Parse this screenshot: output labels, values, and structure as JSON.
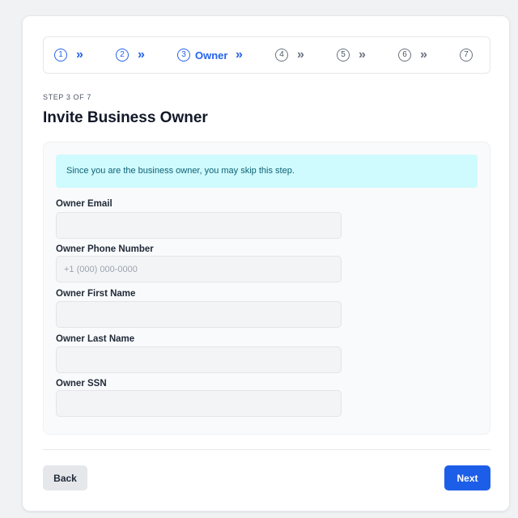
{
  "stepper": {
    "steps": [
      {
        "number": "1",
        "label": "",
        "state": "done"
      },
      {
        "number": "2",
        "label": "",
        "state": "done"
      },
      {
        "number": "3",
        "label": "Owner",
        "state": "current"
      },
      {
        "number": "4",
        "label": "",
        "state": "upcoming"
      },
      {
        "number": "5",
        "label": "",
        "state": "upcoming"
      },
      {
        "number": "6",
        "label": "",
        "state": "upcoming"
      },
      {
        "number": "7",
        "label": "",
        "state": "upcoming"
      }
    ],
    "separator_glyph": "»",
    "active_color": "#2563eb",
    "inactive_color": "#6b7280"
  },
  "header": {
    "kicker": "STEP 3 OF 7",
    "title": "Invite Business Owner"
  },
  "notice": {
    "text": "Since you are the business owner, you may skip this step.",
    "background": "#cffafe"
  },
  "form": {
    "fields": [
      {
        "label": "Owner Email",
        "value": "",
        "placeholder": ""
      },
      {
        "label": "Owner Phone Number",
        "value": "",
        "placeholder": "+1 (000) 000-0000"
      },
      {
        "label": "Owner First Name",
        "value": "",
        "placeholder": ""
      },
      {
        "label": "Owner Last Name",
        "value": "",
        "placeholder": ""
      },
      {
        "label": "Owner SSN",
        "value": "",
        "placeholder": ""
      }
    ]
  },
  "footer": {
    "back_label": "Back",
    "next_label": "Next",
    "accent": "#1d5ee8"
  }
}
